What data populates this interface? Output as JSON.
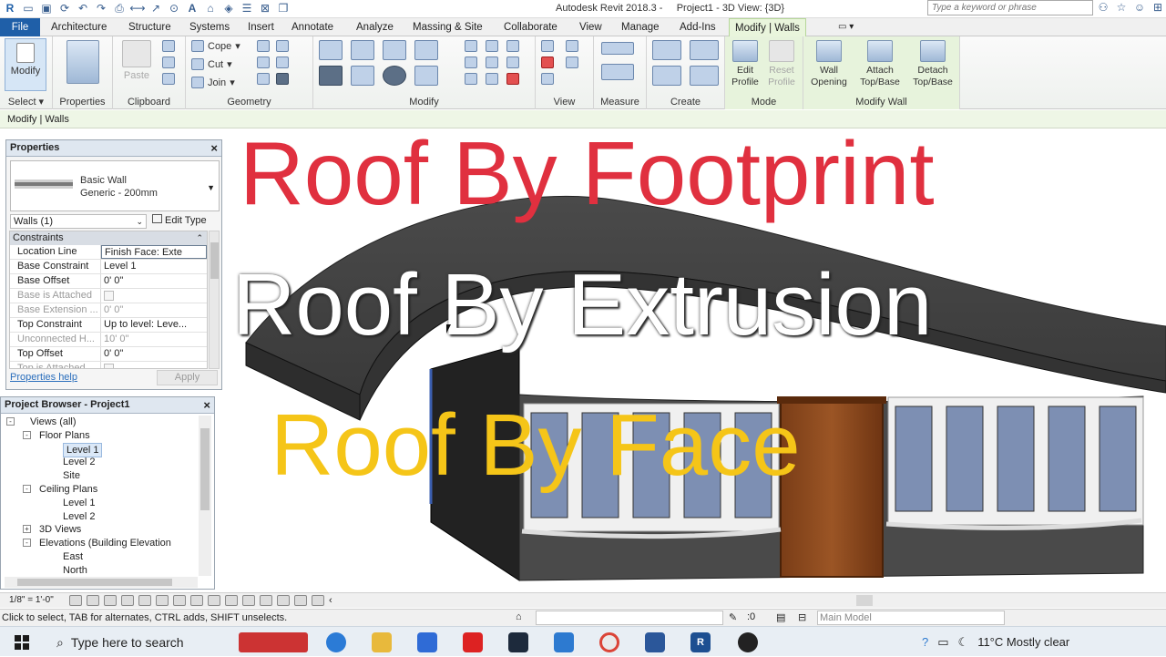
{
  "titlebar": {
    "app_title": "Autodesk Revit 2018.3 -",
    "doc_title": "Project1 - 3D View: {3D}",
    "search_placeholder": "Type a keyword or phrase"
  },
  "ribbon_tabs": [
    "File",
    "Architecture",
    "Structure",
    "Systems",
    "Insert",
    "Annotate",
    "Analyze",
    "Massing & Site",
    "Collaborate",
    "View",
    "Manage",
    "Add-Ins",
    "Modify | Walls"
  ],
  "ribbon": {
    "select_modify": "Modify",
    "select_label": "Select",
    "properties_label": "Properties",
    "paste_label": "Paste",
    "clipboard_label": "Clipboard",
    "cope_label": "Cope",
    "cut_label": "Cut",
    "join_label": "Join",
    "geometry_label": "Geometry",
    "modify_label": "Modify",
    "view_label": "View",
    "measure_label": "Measure",
    "create_label": "Create",
    "edit_profile": "Edit Profile",
    "reset_profile": "Reset Profile",
    "mode_label": "Mode",
    "wall_opening": "Wall Opening",
    "attach_topbase": "Attach Top/Base",
    "detach_topbase": "Detach Top/Base",
    "modify_wall_label": "Modify Wall"
  },
  "context_bar": "Modify | Walls",
  "properties": {
    "title": "Properties",
    "type_family": "Basic Wall",
    "type_name": "Generic - 200mm",
    "instance_selector": "Walls (1)",
    "edit_type": "Edit Type",
    "section": "Constraints",
    "rows": [
      {
        "key": "Location Line",
        "value": "Finish Face: Exte",
        "disabled": false
      },
      {
        "key": "Base Constraint",
        "value": "Level 1",
        "disabled": false
      },
      {
        "key": "Base Offset",
        "value": "0'  0\"",
        "disabled": false
      },
      {
        "key": "Base is Attached",
        "value": "",
        "disabled": true
      },
      {
        "key": "Base Extension ...",
        "value": "0'  0\"",
        "disabled": true
      },
      {
        "key": "Top Constraint",
        "value": "Up to level: Leve...",
        "disabled": false
      },
      {
        "key": "Unconnected H...",
        "value": "10'  0\"",
        "disabled": true
      },
      {
        "key": "Top Offset",
        "value": "0'  0\"",
        "disabled": false
      },
      {
        "key": "Top is Attached",
        "value": "",
        "disabled": true
      }
    ],
    "help_link": "Properties help",
    "apply": "Apply"
  },
  "project_browser": {
    "title": "Project Browser - Project1",
    "tree": [
      {
        "label": "Views (all)",
        "level": 0,
        "toggle": "-"
      },
      {
        "label": "Floor Plans",
        "level": 1,
        "toggle": "-"
      },
      {
        "label": "Level 1",
        "level": 2,
        "toggle": "",
        "selected": true
      },
      {
        "label": "Level 2",
        "level": 2,
        "toggle": ""
      },
      {
        "label": "Site",
        "level": 2,
        "toggle": ""
      },
      {
        "label": "Ceiling Plans",
        "level": 1,
        "toggle": "-"
      },
      {
        "label": "Level 1",
        "level": 2,
        "toggle": ""
      },
      {
        "label": "Level 2",
        "level": 2,
        "toggle": ""
      },
      {
        "label": "3D Views",
        "level": 1,
        "toggle": "+"
      },
      {
        "label": "Elevations (Building Elevation",
        "level": 1,
        "toggle": "-"
      },
      {
        "label": "East",
        "level": 2,
        "toggle": ""
      },
      {
        "label": "North",
        "level": 2,
        "toggle": ""
      }
    ]
  },
  "overlay": {
    "line1": "Roof By Footprint",
    "line2": "Roof By Extrusion",
    "line3": "Roof By Face",
    "colors": {
      "line1": "#e0303f",
      "line2": "#ffffff",
      "line3": "#f5c518"
    }
  },
  "view_control": {
    "scale": "1/8\" = 1'-0\""
  },
  "status": {
    "text": "Click to select, TAB for alternates, CTRL adds, SHIFT unselects.",
    "selection_count": ":0",
    "model": "Main Model"
  },
  "taskbar": {
    "search_placeholder": "Type here to search",
    "weather": "11°C  Mostly clear"
  }
}
